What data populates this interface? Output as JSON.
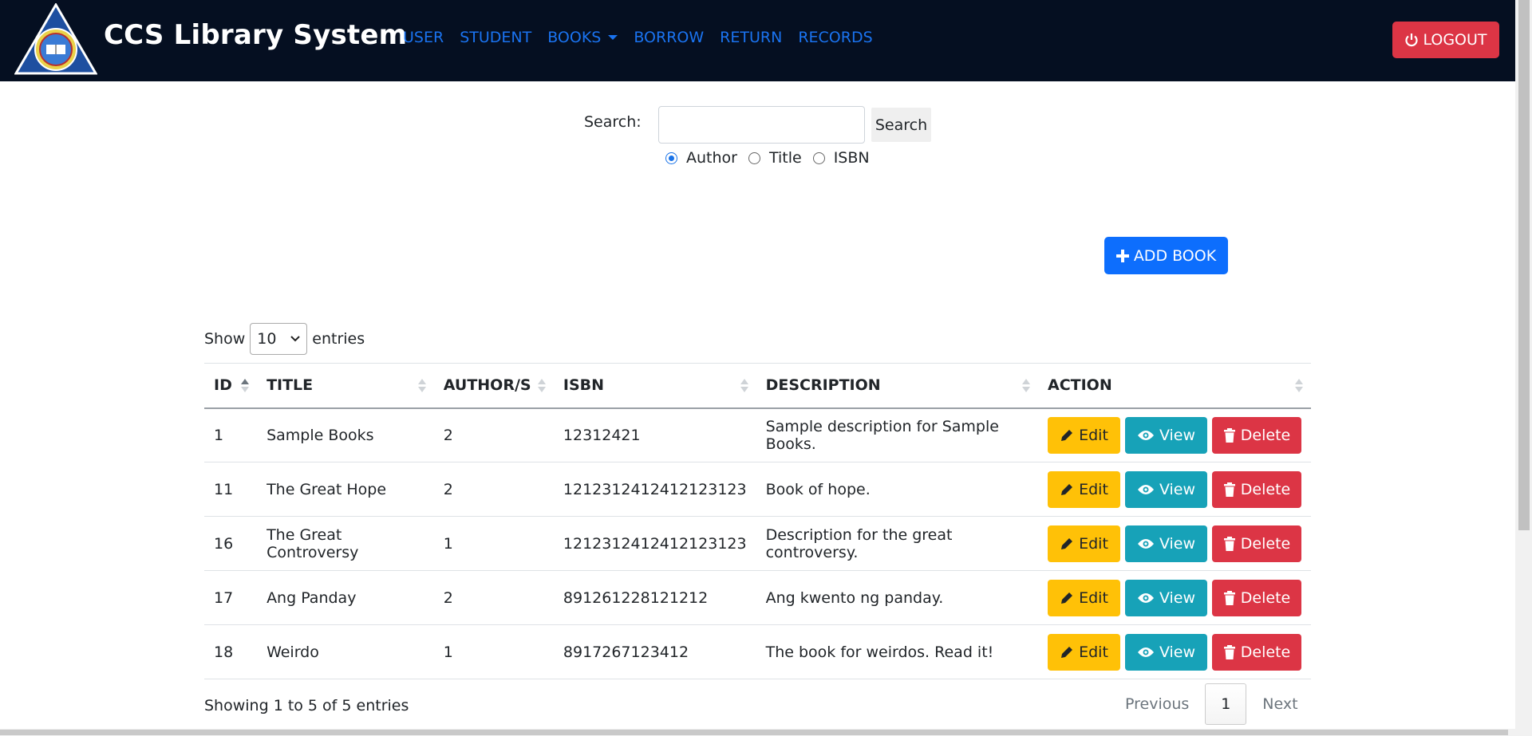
{
  "header": {
    "title": "CCS Library System",
    "nav": [
      "USER",
      "STUDENT",
      "BOOKS",
      "BORROW",
      "RETURN",
      "RECORDS"
    ],
    "logout_label": "LOGOUT"
  },
  "search": {
    "label": "Search:",
    "value": "",
    "button_label": "Search",
    "options": [
      "Author",
      "Title",
      "ISBN"
    ],
    "selected": "Author"
  },
  "add_book_label": "ADD BOOK",
  "entries": {
    "show_label": "Show",
    "value": "10",
    "suffix": "entries"
  },
  "table": {
    "columns": [
      "ID",
      "TITLE",
      "AUTHOR/S",
      "ISBN",
      "DESCRIPTION",
      "ACTION"
    ],
    "rows": [
      {
        "id": "1",
        "title": "Sample Books",
        "authors": "2",
        "isbn": "12312421",
        "description": "Sample description for Sample Books."
      },
      {
        "id": "11",
        "title": "The Great Hope",
        "authors": "2",
        "isbn": "1212312412412123123",
        "description": "Book of hope."
      },
      {
        "id": "16",
        "title": "The Great Controversy",
        "authors": "1",
        "isbn": "1212312412412123123",
        "description": "Description for the great controversy."
      },
      {
        "id": "17",
        "title": "Ang Panday",
        "authors": "2",
        "isbn": "891261228121212",
        "description": "Ang kwento ng panday."
      },
      {
        "id": "18",
        "title": "Weirdo",
        "authors": "1",
        "isbn": "8917267123412",
        "description": "The book for weirdos. Read it!"
      }
    ],
    "actions": {
      "edit": "Edit",
      "view": "View",
      "delete": "Delete"
    }
  },
  "footer": {
    "info": "Showing 1 to 5 of 5 entries",
    "previous": "Previous",
    "page": "1",
    "next": "Next"
  },
  "colors": {
    "navbar": "#050f21",
    "link": "#1a73f0",
    "danger": "#dc3545",
    "primary": "#0d6efd",
    "warning": "#ffc107",
    "info": "#17a2b8"
  }
}
